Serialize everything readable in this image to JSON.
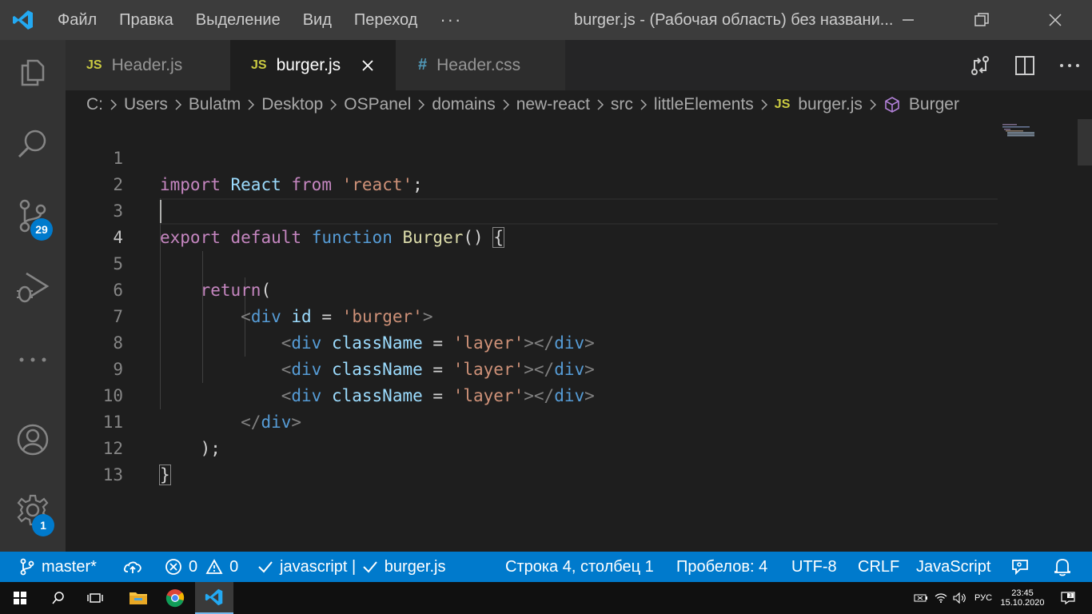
{
  "titlebar": {
    "menu": [
      "Файл",
      "Правка",
      "Выделение",
      "Вид",
      "Переход",
      "···"
    ],
    "title": "burger.js - (Рабочая область) без названи..."
  },
  "activity": {
    "scm_badge": "29",
    "settings_badge": "1"
  },
  "tabs": [
    {
      "icon": "JS",
      "label": "Header.js",
      "active": false
    },
    {
      "icon": "JS",
      "label": "burger.js",
      "active": true
    },
    {
      "icon": "#",
      "label": "Header.css",
      "active": false
    }
  ],
  "breadcrumb": [
    "C:",
    "Users",
    "Bulatm",
    "Desktop",
    "OSPanel",
    "domains",
    "new-react",
    "src",
    "littleElements",
    "burger.js",
    "Burger"
  ],
  "breadcrumb_file_icon": "JS",
  "line_numbers": [
    "1",
    "2",
    "3",
    "4",
    "5",
    "6",
    "7",
    "8",
    "9",
    "10",
    "11",
    "12",
    "13"
  ],
  "code": {
    "l1": [
      "import",
      "React",
      "from",
      "'react'",
      ";"
    ],
    "l3": [
      "export",
      "default",
      "function",
      "Burger",
      "()",
      "{"
    ],
    "l5": [
      "return",
      "("
    ],
    "l6": [
      "<",
      "div",
      "id",
      "=",
      "'burger'",
      ">"
    ],
    "l7": [
      "<",
      "div",
      "className",
      "=",
      "'layer'",
      "></",
      "div",
      ">"
    ],
    "l10": [
      "</",
      "div",
      ">"
    ],
    "l11": [
      ");"
    ],
    "l12": [
      "}"
    ]
  },
  "status": {
    "branch": "master*",
    "errors": "0",
    "warnings": "0",
    "lint": "javascript | ",
    "lint_file": "burger.js",
    "position": "Строка 4, столбец 1",
    "spaces": "Пробелов: 4",
    "encoding": "UTF-8",
    "eol": "CRLF",
    "language": "JavaScript"
  },
  "taskbar": {
    "lang": "РУС",
    "time": "23:45",
    "date": "15.10.2020"
  },
  "colors": {
    "statusbar": "#007acc",
    "titlebar": "#3c3c3c",
    "activitybar": "#333333",
    "editor": "#1e1e1e"
  }
}
